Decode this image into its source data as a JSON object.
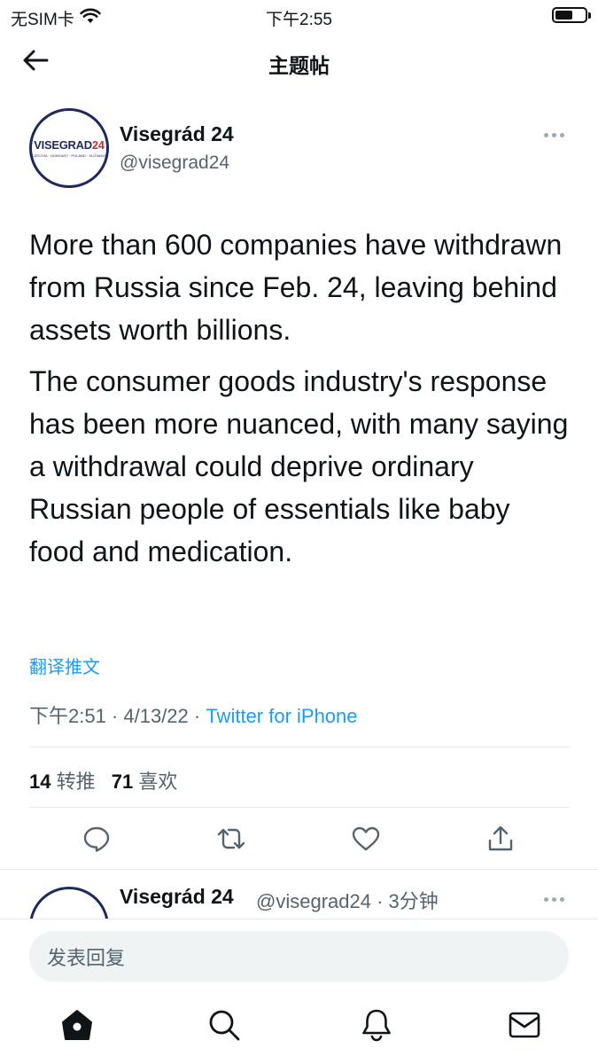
{
  "status_bar": {
    "carrier": "无SIM卡",
    "time": "下午2:55",
    "battery_level": 0.6
  },
  "header": {
    "title": "主题帖",
    "back_icon": "arrow-left-icon"
  },
  "tweet": {
    "author_name": "Visegrád 24",
    "author_handle": "@visegrad24",
    "avatar_text_main": "VISEGRAD",
    "avatar_text_accent": "24",
    "avatar_subtext": "CZECHIA · HUNGARY · POLAND · SLOVAKIA",
    "paragraphs": [
      "More than 600 companies have withdrawn from Russia since Feb. 24, leaving behind assets worth billions.",
      "The consumer goods industry's response has been more nuanced, with many saying a withdrawal could deprive ordinary Russian people of essentials like baby food and medication."
    ],
    "translate_label": "翻译推文",
    "timestamp": "下午2:51 · 4/13/22 · ",
    "source": "Twitter for iPhone",
    "retweets_count": "14",
    "retweets_label": "转推",
    "likes_count": "71",
    "likes_label": "喜欢"
  },
  "reply_preview": {
    "author_name": "Visegrád 24",
    "meta": "@visegrad24 · 3分钟"
  },
  "compose": {
    "placeholder": "发表回复"
  },
  "colors": {
    "accent": "#1d9bf0",
    "text": "#0f1419",
    "secondary": "#536471",
    "logo_navy": "#1f2a5c",
    "logo_red": "#d52b2b"
  }
}
